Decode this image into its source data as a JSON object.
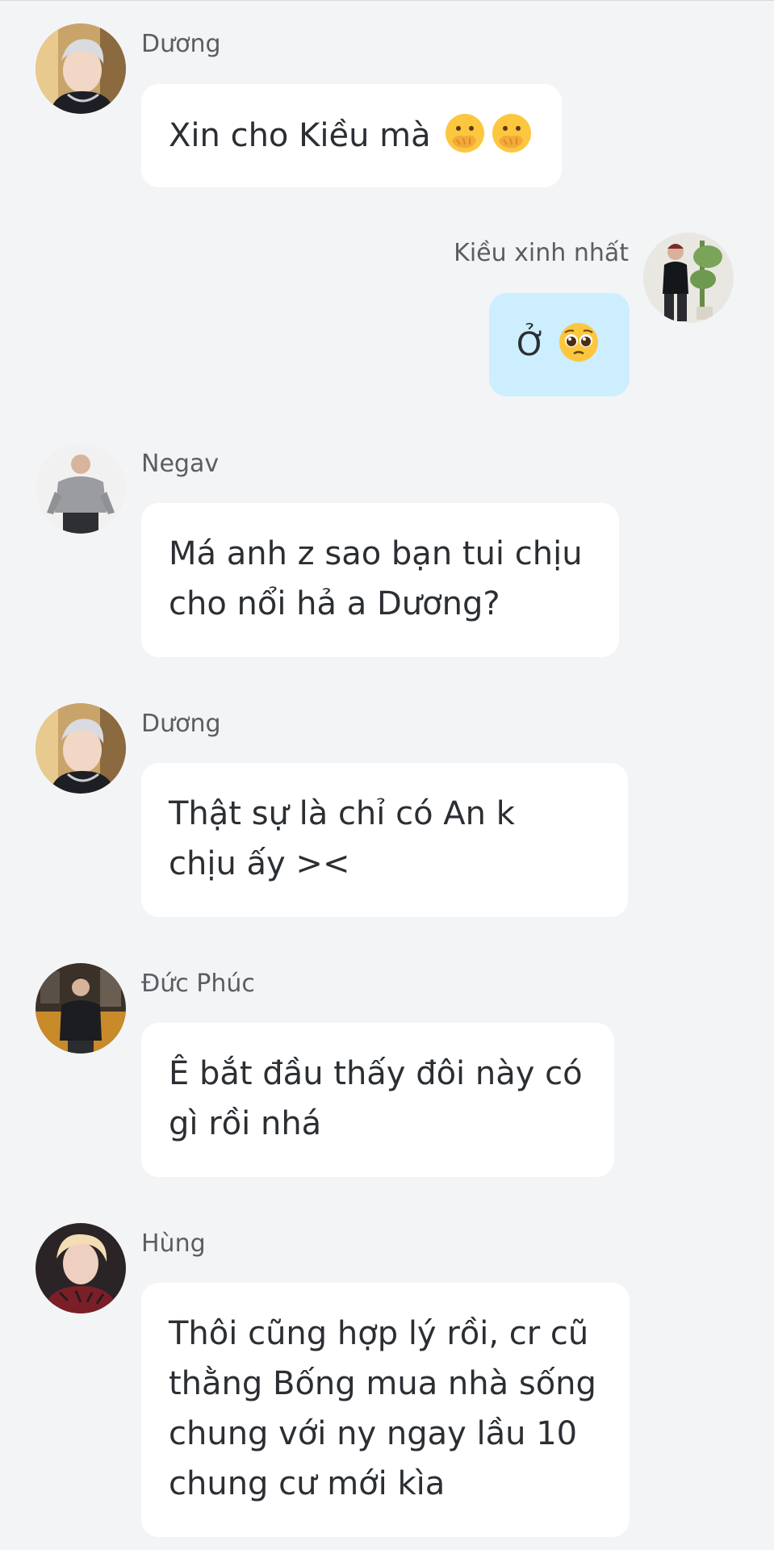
{
  "messages": [
    {
      "sender": "Dương",
      "avatar_icon": "silver-hair-man-avatar",
      "lines": [
        "Xin cho Kiều mà"
      ],
      "emojis": [
        "hand-over-mouth-emoji",
        "hand-over-mouth-emoji"
      ]
    },
    {
      "sender": "Kiều xinh nhất",
      "avatar_icon": "man-black-outfit-avatar",
      "lines": [
        "Ở"
      ],
      "emojis": [
        "pleading-face-emoji"
      ],
      "mine": true
    },
    {
      "sender": "Negav",
      "avatar_icon": "man-grey-sweater-avatar",
      "lines": [
        "Má anh z sao bạn tui chịu",
        "cho nổi hả a Dương?"
      ]
    },
    {
      "sender": "Dương",
      "avatar_icon": "silver-hair-man-avatar",
      "lines": [
        "Thật sự là chỉ có An k",
        "chịu ấy ><"
      ]
    },
    {
      "sender": "Đức Phúc",
      "avatar_icon": "man-cafe-avatar",
      "lines": [
        "Ê bắt đầu thấy đôi này có",
        "gì rồi nhá"
      ]
    },
    {
      "sender": "Hùng",
      "avatar_icon": "blonde-man-avatar",
      "lines": [
        "Thôi cũng hợp lý rồi, cr cũ",
        "thằng Bống mua nhà sống",
        "chung với ny ngay lầu 10",
        "chung cư mới kìa"
      ]
    }
  ],
  "colors": {
    "background": "#f3f4f6",
    "bubble_other": "#ffffff",
    "bubble_mine": "#cdeefe",
    "name_text": "#595e63",
    "message_text": "#2b2f33"
  }
}
